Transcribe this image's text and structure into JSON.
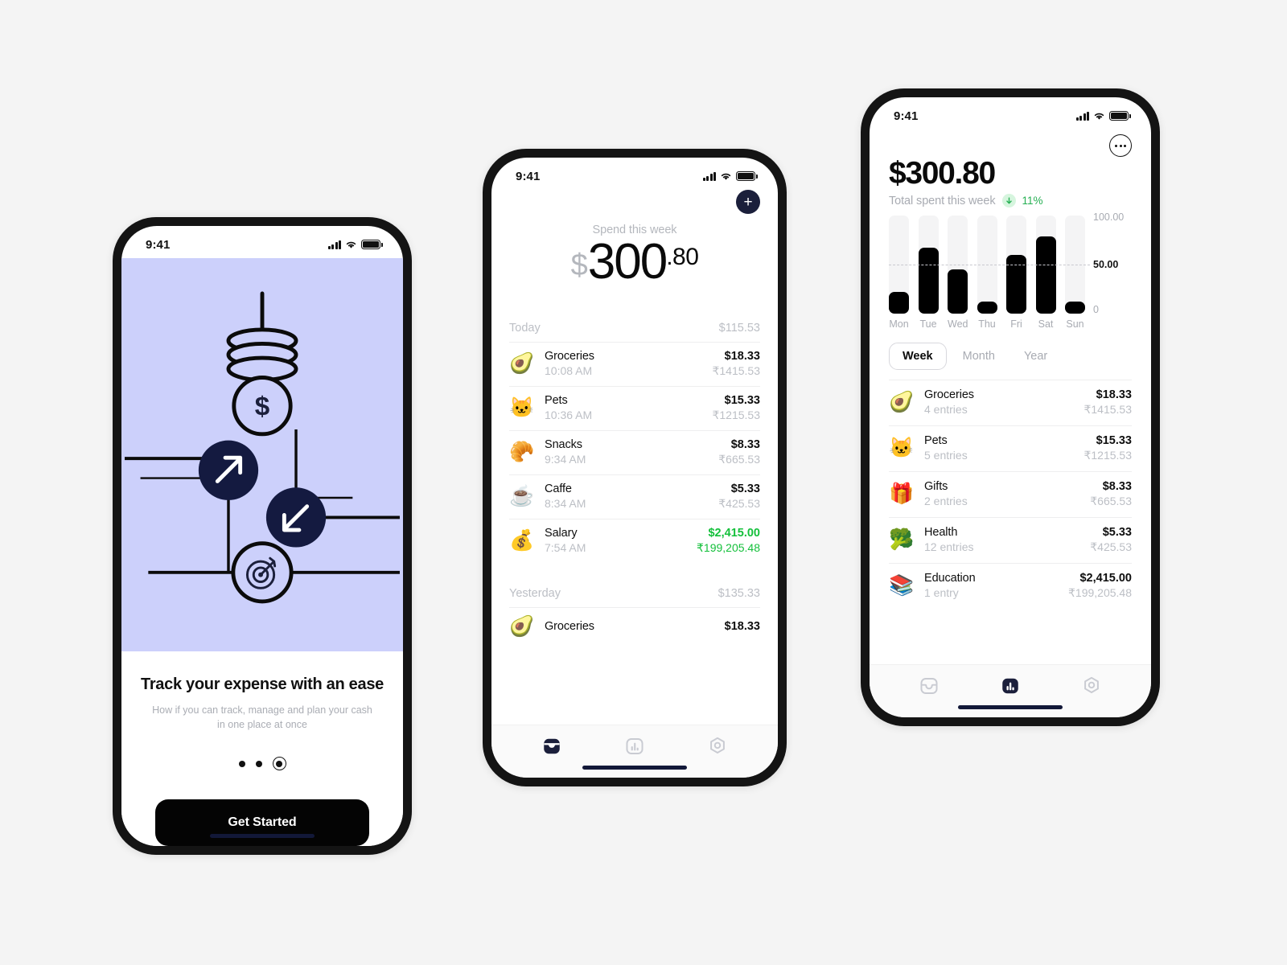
{
  "statusbar": {
    "time": "9:41"
  },
  "phone1": {
    "screen_name": "onboarding",
    "illustration": {
      "coin_stack_icon": "coin-stack-icon",
      "dollar_circle_icon": "dollar-circle-icon",
      "arrow_up_right_icon": "arrow-up-right-icon",
      "arrow_down_left_icon": "arrow-down-left-icon",
      "target_icon": "target-icon"
    },
    "title": "Track your expense with an ease",
    "subtitle_line1": "How if you can track, manage and plan your cash",
    "subtitle_line2": "in one place at once",
    "pager": {
      "total": 3,
      "active_index": 2
    },
    "cta_label": "Get Started",
    "accent_bg": "#ccd0fb",
    "cta_bg": "#040404"
  },
  "phone2": {
    "screen_name": "transactions",
    "add_button_label": "+",
    "header_label": "Spend this week",
    "amount": {
      "currency": "$",
      "integer": "300",
      "decimal": ".80"
    },
    "groups": [
      {
        "label": "Today",
        "total": "$115.53",
        "items": [
          {
            "emoji": "🥑",
            "icon_name": "avocado-icon",
            "name": "Groceries",
            "time": "10:08 AM",
            "amount": "$18.33",
            "secondary": "₹1415.53",
            "income": false
          },
          {
            "emoji": "🐱",
            "icon_name": "cat-face-icon",
            "name": "Pets",
            "time": "10:36 AM",
            "amount": "$15.33",
            "secondary": "₹1215.53",
            "income": false
          },
          {
            "emoji": "🥐",
            "icon_name": "croissant-icon",
            "name": "Snacks",
            "time": "9:34 AM",
            "amount": "$8.33",
            "secondary": "₹665.53",
            "income": false
          },
          {
            "emoji": "☕",
            "icon_name": "coffee-icon",
            "name": "Caffe",
            "time": "8:34 AM",
            "amount": "$5.33",
            "secondary": "₹425.53",
            "income": false
          },
          {
            "emoji": "💰",
            "icon_name": "money-bag-icon",
            "name": "Salary",
            "time": "7:54 AM",
            "amount": "$2,415.00",
            "secondary": "₹199,205.48",
            "income": true
          }
        ]
      },
      {
        "label": "Yesterday",
        "total": "$135.33",
        "items": [
          {
            "emoji": "🥑",
            "icon_name": "avocado-icon",
            "name": "Groceries",
            "time": "",
            "amount": "$18.33",
            "secondary": "",
            "income": false
          }
        ]
      }
    ],
    "tabs": [
      {
        "icon_name": "inbox-icon",
        "active": true
      },
      {
        "icon_name": "bar-chart-icon",
        "active": false
      },
      {
        "icon_name": "hexagon-target-icon",
        "active": false
      }
    ],
    "income_color": "#14c03b"
  },
  "phone3": {
    "screen_name": "statistics",
    "more_button_label": "more-options",
    "total": "$300.80",
    "subtitle": "Total spent this week",
    "delta": {
      "direction": "down",
      "value": "11%",
      "color": "#25af52",
      "badge_bg": "#d6f5de"
    },
    "segments": [
      {
        "label": "Week",
        "active": true
      },
      {
        "label": "Month",
        "active": false
      },
      {
        "label": "Year",
        "active": false
      }
    ],
    "categories": [
      {
        "emoji": "🥑",
        "icon_name": "avocado-icon",
        "name": "Groceries",
        "entries": "4 entries",
        "amount": "$18.33",
        "secondary": "₹1415.53"
      },
      {
        "emoji": "🐱",
        "icon_name": "cat-face-icon",
        "name": "Pets",
        "entries": "5 entries",
        "amount": "$15.33",
        "secondary": "₹1215.53"
      },
      {
        "emoji": "🎁",
        "icon_name": "gift-icon",
        "name": "Gifts",
        "entries": "2 entries",
        "amount": "$8.33",
        "secondary": "₹665.53"
      },
      {
        "emoji": "🥦",
        "icon_name": "broccoli-icon",
        "name": "Health",
        "entries": "12 entries",
        "amount": "$5.33",
        "secondary": "₹425.53"
      },
      {
        "emoji": "📚",
        "icon_name": "books-icon",
        "name": "Education",
        "entries": "1 entry",
        "amount": "$2,415.00",
        "secondary": "₹199,205.48"
      }
    ],
    "tabs": [
      {
        "icon_name": "inbox-icon",
        "active": false
      },
      {
        "icon_name": "bar-chart-icon",
        "active": true
      },
      {
        "icon_name": "hexagon-target-icon",
        "active": false
      }
    ]
  },
  "chart_data": {
    "type": "bar",
    "title": "",
    "categories": [
      "Mon",
      "Tue",
      "Wed",
      "Thu",
      "Fri",
      "Sat",
      "Sun"
    ],
    "values": [
      22,
      67,
      45,
      9,
      60,
      79,
      9
    ],
    "track_max": 100,
    "ylim": [
      0,
      100
    ],
    "yticks": [
      0,
      50,
      100
    ],
    "ytick_labels": [
      "0",
      "50.00",
      "100.00"
    ],
    "reference_line": 50,
    "xlabel": "",
    "ylabel": "",
    "grid": false,
    "legend": "none",
    "bar_color": "#000000",
    "track_color": "#f4f4f5"
  }
}
